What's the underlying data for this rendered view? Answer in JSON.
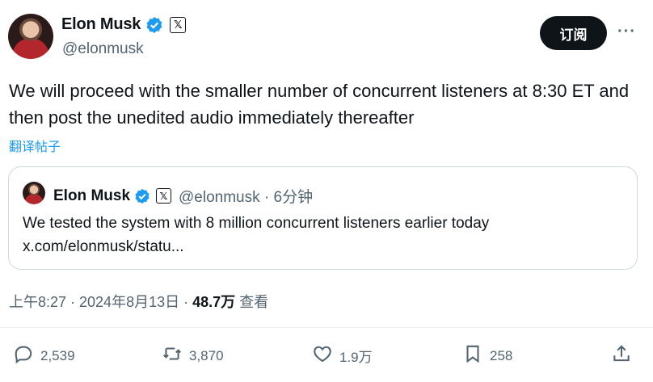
{
  "author": {
    "name": "Elon Musk",
    "handle": "@elonmusk",
    "x_badge": "𝕏"
  },
  "subscribe_label": "订阅",
  "more_label": "···",
  "tweet": {
    "text": "We will proceed with the smaller number of concurrent listeners at 8:30 ET and then post the unedited audio immediately thereafter",
    "translate_label": "翻译帖子"
  },
  "quoted": {
    "name": "Elon Musk",
    "handle_time": "@elonmusk · 6分钟",
    "text": "We tested the system with 8 million concurrent listeners earlier today",
    "link": "x.com/elonmusk/statu..."
  },
  "meta": {
    "time_date": "上午8:27 · 2024年8月13日 · ",
    "views": "48.7万",
    "views_label": " 查看"
  },
  "actions": {
    "replies": "2,539",
    "reposts": "3,870",
    "likes": "1.9万",
    "bookmarks": "258"
  },
  "colors": {
    "accent": "#1d9bf0",
    "text": "#0f1419",
    "muted": "#536471",
    "border": "#cfd9de"
  }
}
